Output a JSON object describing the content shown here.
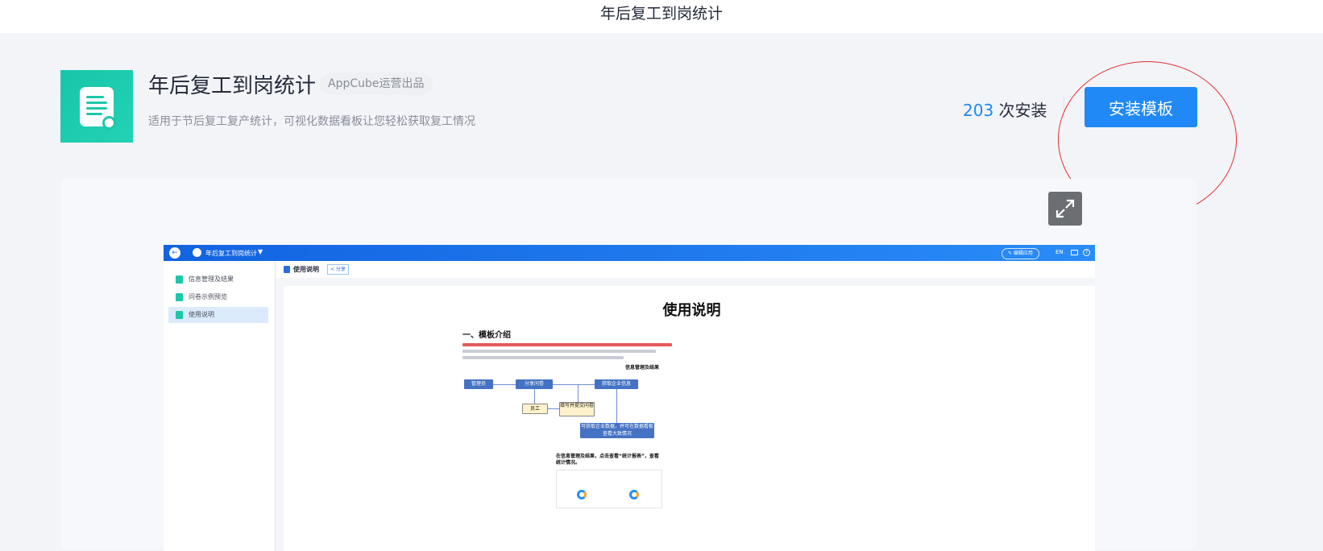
{
  "page": {
    "title": "年后复工到岗统计"
  },
  "template": {
    "name": "年后复工到岗统计",
    "vendor_badge": "AppCube运营出品",
    "description": "适用于节后复工复产统计，可视化数据看板让您轻松获取复工情况",
    "icon": "document-gear-icon",
    "install_count": "203",
    "install_count_suffix": " 次安装",
    "install_button": "安装模板"
  },
  "preview": {
    "expand_icon": "expand-arrows-icon",
    "app": {
      "title": "年后复工到岗统计",
      "caret": "▼",
      "back_icon": "←",
      "edit_button": "✎ 编辑应用",
      "lang": "EN",
      "help_icon": "?",
      "sidebar": [
        {
          "label": "信息管理及结果"
        },
        {
          "label": "问卷示例预览"
        },
        {
          "label": "使用说明",
          "active": true
        }
      ],
      "tab": {
        "label": "使用说明",
        "share": "< 分享"
      },
      "doc": {
        "heading": "使用说明",
        "section": "一、模板介绍",
        "flowchart": {
          "nodes": [
            "管理员",
            "分享问卷",
            "获取企业信息",
            "员工",
            "填写并提交问卷",
            "可获取企业数据，并可在数据看板查看大致情况"
          ],
          "note": "信息管理及结果"
        },
        "caption": "在信息管理及结果，点击查看“统计报表”，查看统计情况。"
      }
    }
  },
  "colors": {
    "accent": "#2089f5",
    "icon_bg": "#1ec7aa",
    "highlight_circle": "#e03030"
  }
}
